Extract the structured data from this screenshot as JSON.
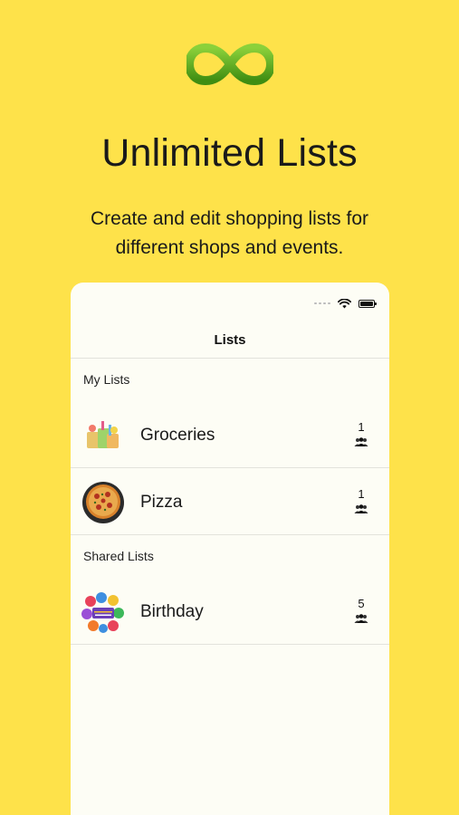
{
  "hero": {
    "logo_icon": "infinity-icon",
    "title": "Unlimited Lists",
    "subtitle_line1": "Create and edit shopping lists for",
    "subtitle_line2": "different shops and events."
  },
  "phone": {
    "status_icons": [
      "signal-icon",
      "wifi-icon",
      "battery-icon"
    ],
    "nav_title": "Lists",
    "sections": [
      {
        "label": "My Lists",
        "items": [
          {
            "name": "Groceries",
            "count": "1",
            "thumb_icon": "grocery-bags-image",
            "people_icon": "people-icon"
          },
          {
            "name": "Pizza",
            "count": "1",
            "thumb_icon": "pizza-image",
            "people_icon": "people-icon"
          }
        ]
      },
      {
        "label": "Shared Lists",
        "items": [
          {
            "name": "Birthday",
            "count": "5",
            "thumb_icon": "birthday-balloons-image",
            "people_icon": "people-icon"
          }
        ]
      }
    ]
  },
  "colors": {
    "background": "#FEE24A",
    "card": "#FDFDF5",
    "logo_green": "#5DAA1C"
  }
}
